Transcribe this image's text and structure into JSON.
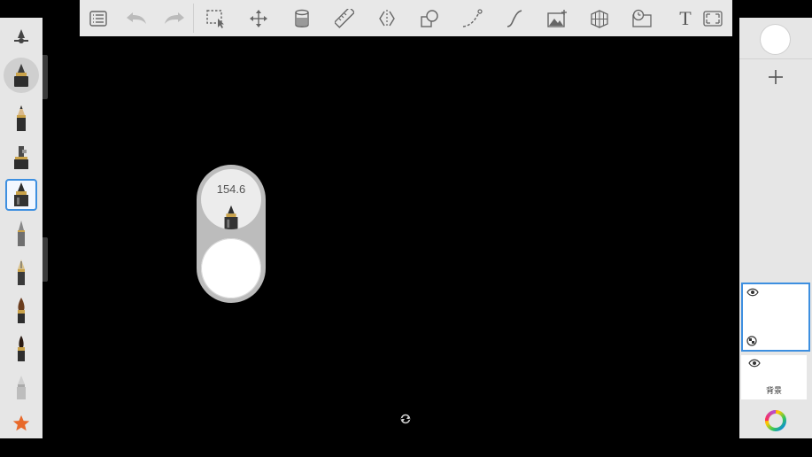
{
  "puck": {
    "brush_size": "154.6"
  },
  "toolbar": {
    "tools": [
      "list-icon",
      "undo-icon",
      "redo-icon",
      "selection-icon",
      "transform-icon",
      "bucket-fill-icon",
      "ruler-icon",
      "symmetry-icon",
      "shapes-icon",
      "perspective-stroke-icon",
      "curve-icon",
      "add-image-icon",
      "perspective-grid-icon",
      "time-lapse-icon",
      "text-tool",
      "canvas-frame-icon"
    ],
    "text_tool_label": "T"
  },
  "layers": [
    {
      "name": "",
      "selected": true
    },
    {
      "name": "背景",
      "selected": false
    }
  ],
  "brushes": [
    "brush-settings",
    "marker",
    "pencil",
    "airbrush",
    "inking-pen",
    "ballpoint-pen",
    "fountain-pen",
    "paint-brush",
    "calligraphy-brush",
    "eraser",
    "favorites-star"
  ],
  "colors": {
    "accent": "#3d8fe0",
    "toolbar_bg": "#e8e8e8",
    "panel_bg": "#e6e6e6",
    "canvas": "#000000",
    "star": "#e8692a"
  }
}
